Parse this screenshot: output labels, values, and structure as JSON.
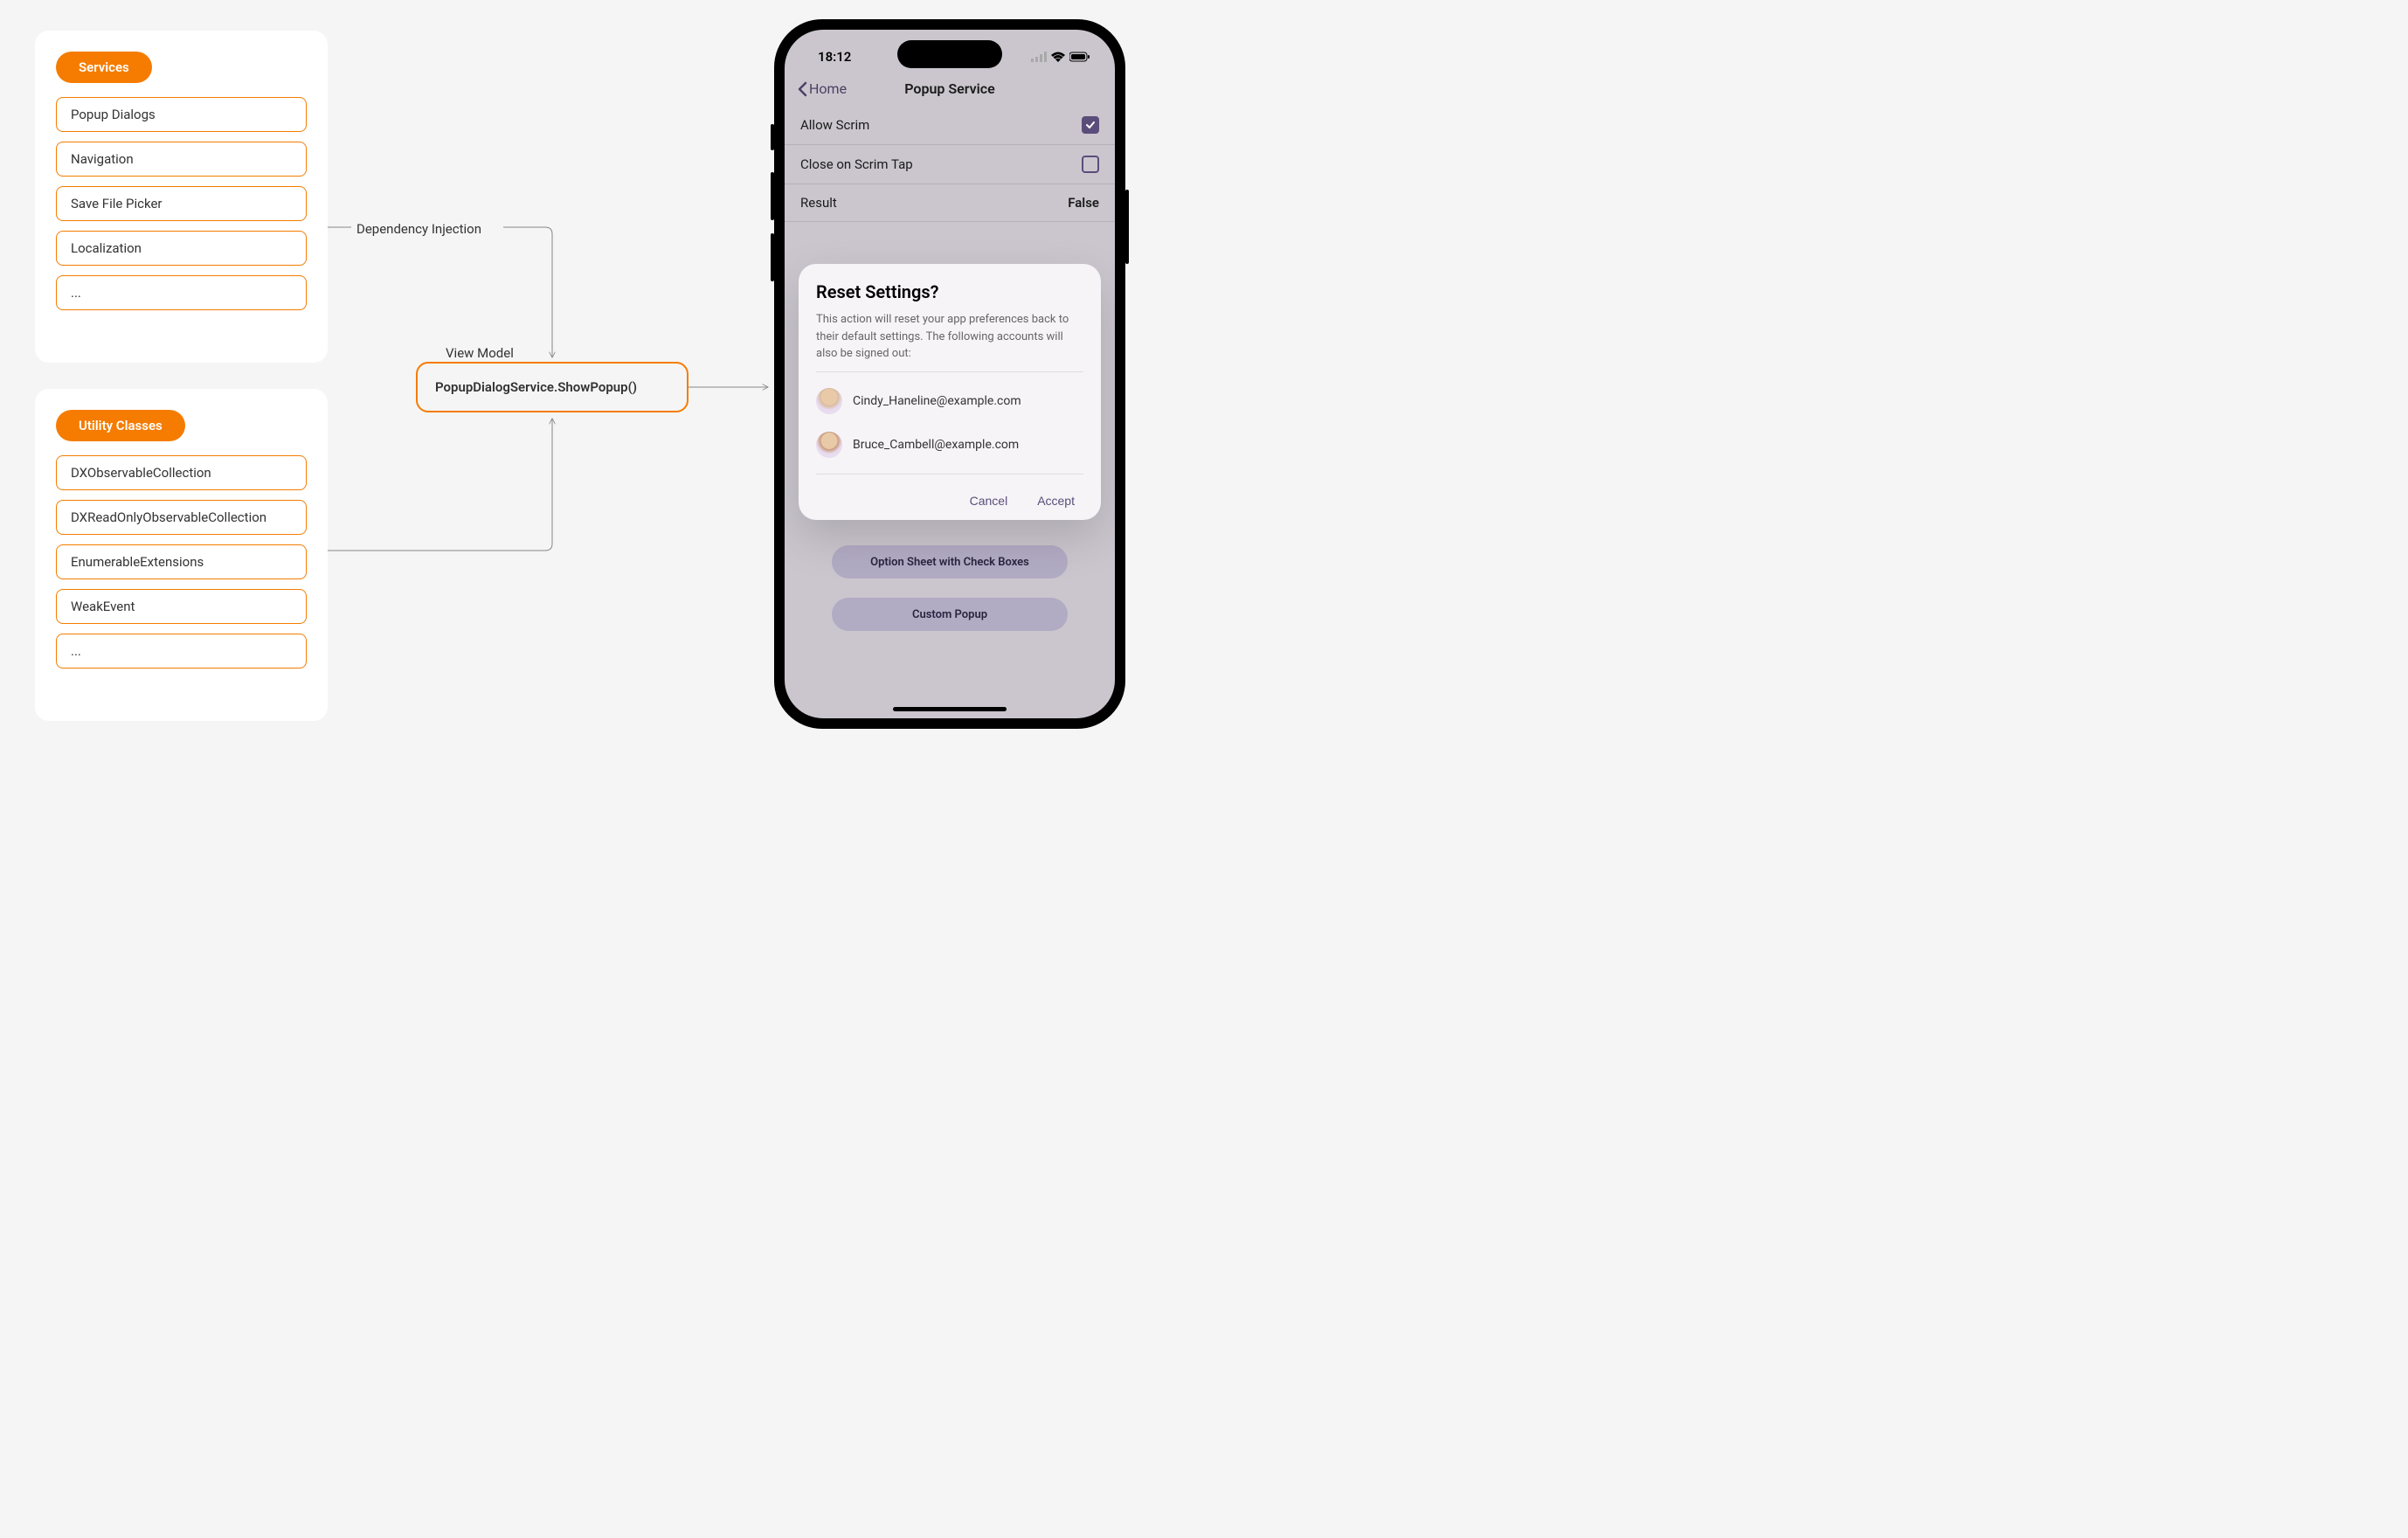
{
  "services": {
    "header": "Services",
    "items": [
      "Popup Dialogs",
      "Navigation",
      "Save File Picker",
      "Localization",
      "..."
    ]
  },
  "utility": {
    "header": "Utility Classes",
    "items": [
      "DXObservableCollection",
      "DXReadOnlyObservableCollection",
      "EnumerableExtensions",
      "WeakEvent",
      "..."
    ]
  },
  "diagram": {
    "di_label": "Dependency Injection",
    "view_model_label": "View Model",
    "view_model_text": "PopupDialogService.ShowPopup()"
  },
  "phone": {
    "time": "18:12",
    "nav_back": "Home",
    "nav_title": "Popup Service",
    "rows": {
      "allow_scrim": {
        "label": "Allow Scrim",
        "checked": true
      },
      "close_on_tap": {
        "label": "Close on Scrim Tap",
        "checked": false
      },
      "result": {
        "label": "Result",
        "value": "False"
      }
    },
    "popup": {
      "title": "Reset Settings?",
      "desc": "This action will reset your app preferences back to their default settings. The following accounts will also be signed out:",
      "accounts": [
        "Cindy_Haneline@example.com",
        "Bruce_Cambell@example.com"
      ],
      "cancel": "Cancel",
      "accept": "Accept"
    },
    "bg_buttons": [
      "Option Sheet with Check Boxes",
      "Custom Popup"
    ]
  }
}
